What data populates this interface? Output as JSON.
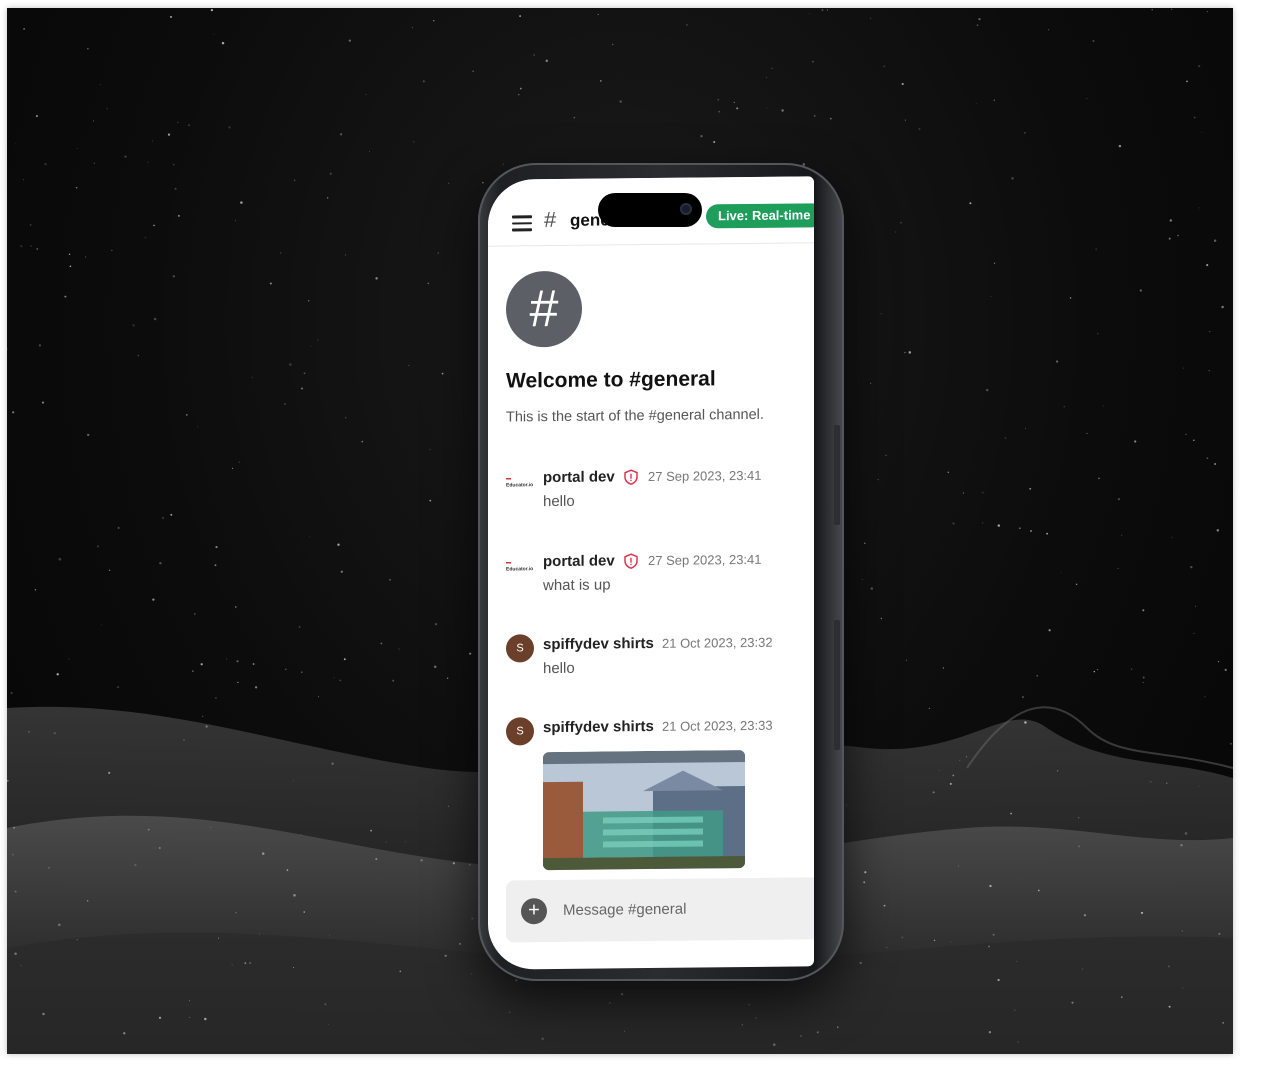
{
  "topbar": {
    "channel_title": "general",
    "live_badge": "Live: Real-time"
  },
  "channel": {
    "welcome": "Welcome to #general",
    "start_text": "This is the start of the #general channel."
  },
  "messages": [
    {
      "author": "portal dev",
      "time": "27 Sep 2023, 23:41",
      "text": "hello",
      "avatar": "logo",
      "badge": "shield-icon"
    },
    {
      "author": "portal dev",
      "time": "27 Sep 2023, 23:41",
      "text": "what is up",
      "avatar": "logo",
      "badge": "shield-icon"
    },
    {
      "author": "spiffydev shirts",
      "time": "21 Oct 2023, 23:32",
      "text": "hello",
      "avatar_initial": "S"
    },
    {
      "author": "spiffydev shirts",
      "time": "21 Oct 2023, 23:33",
      "text": "",
      "avatar_initial": "S",
      "attachment": "game-screenshot-image"
    }
  ],
  "composer": {
    "placeholder": "Message #general"
  },
  "colors": {
    "live_green": "#1f9d5a",
    "shield_red": "#e0344d",
    "avatar_brown": "#6b3f2a"
  }
}
